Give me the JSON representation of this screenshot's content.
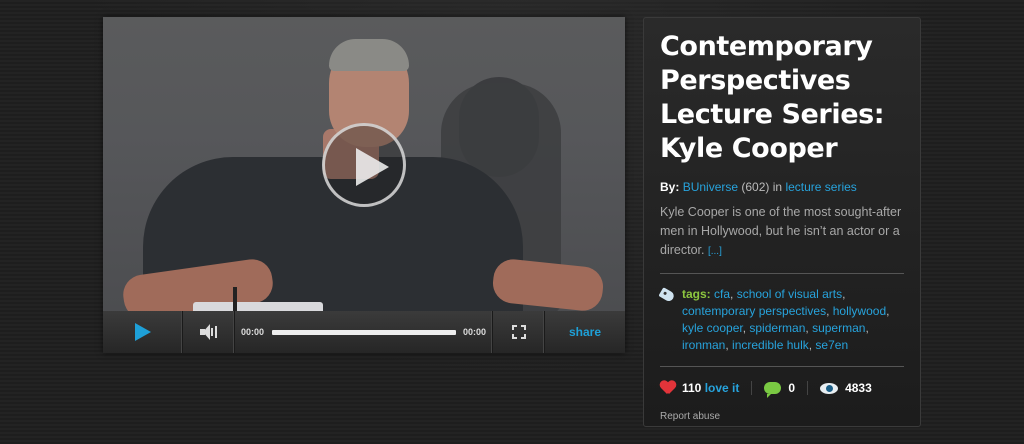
{
  "video": {
    "current_time": "00:00",
    "duration": "00:00",
    "share_label": "share"
  },
  "info": {
    "title": "Contemporary Perspectives Lecture Series: Kyle Cooper",
    "by_label": "By:",
    "author": "BUniverse",
    "author_count": "(602)",
    "in_label": "in",
    "category": "lecture series",
    "description": "Kyle Cooper is one of the most sought-after men in Hollywood, but he isn’t an actor or a director.",
    "more_label": "[...]",
    "tags_label": "tags:",
    "tags": [
      "cfa",
      "school of visual arts",
      "contemporary perspectives",
      "hollywood",
      "kyle cooper",
      "spiderman",
      "superman",
      "ironman",
      "incredible hulk",
      "se7en"
    ],
    "loves": "110",
    "love_label": "love it",
    "comments": "0",
    "views": "4833",
    "report_label": "Report abuse"
  },
  "colors": {
    "link": "#27a3dc",
    "tags_label": "#8dc63f",
    "heart": "#e2343a",
    "comment": "#7ac943"
  },
  "icons": [
    "play-icon",
    "volume-icon",
    "fullscreen-icon",
    "tag-icon",
    "heart-icon",
    "comment-icon",
    "eye-icon"
  ]
}
